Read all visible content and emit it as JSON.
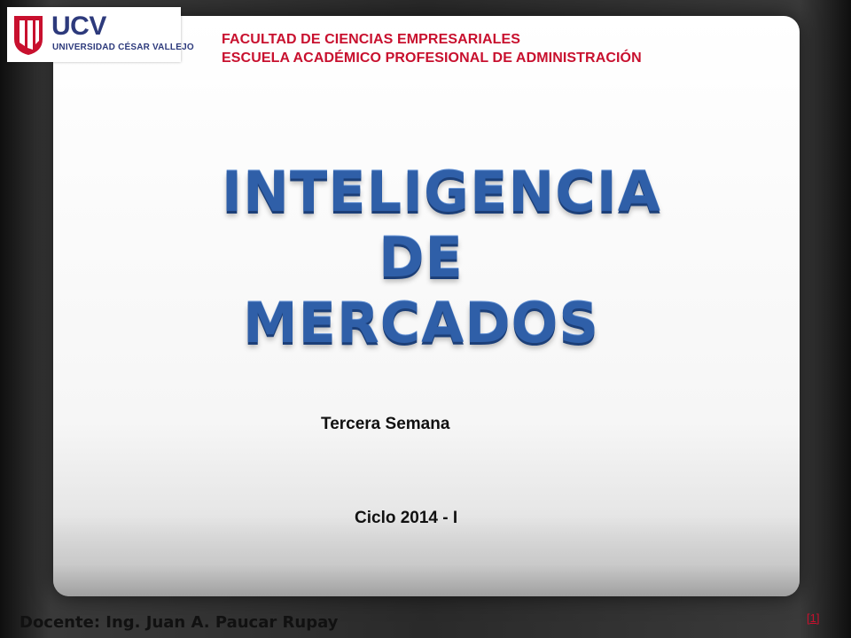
{
  "logo": {
    "word": "UCV",
    "subtitle": "UNIVERSIDAD CÉSAR VALLEJO",
    "colors": {
      "red": "#c8102e",
      "navy": "#2d3a7c"
    }
  },
  "header": {
    "faculty": "FACULTAD DE CIENCIAS EMPRESARIALES",
    "school": "ESCUELA ACADÉMICO PROFESIONAL DE ADMINISTRACIÓN"
  },
  "title": {
    "line1": "INTELIGENCIA",
    "line2": "DE",
    "line3": "MERCADOS"
  },
  "subtitle": "Tercera Semana",
  "cycle": "Ciclo 2014 - I",
  "footer": {
    "teacher": "Docente: Ing. Juan A. Paucar Rupay",
    "footnote_link": "[1]"
  },
  "colors": {
    "title_blue": "#2f5fa8",
    "header_red": "#c8102e"
  }
}
